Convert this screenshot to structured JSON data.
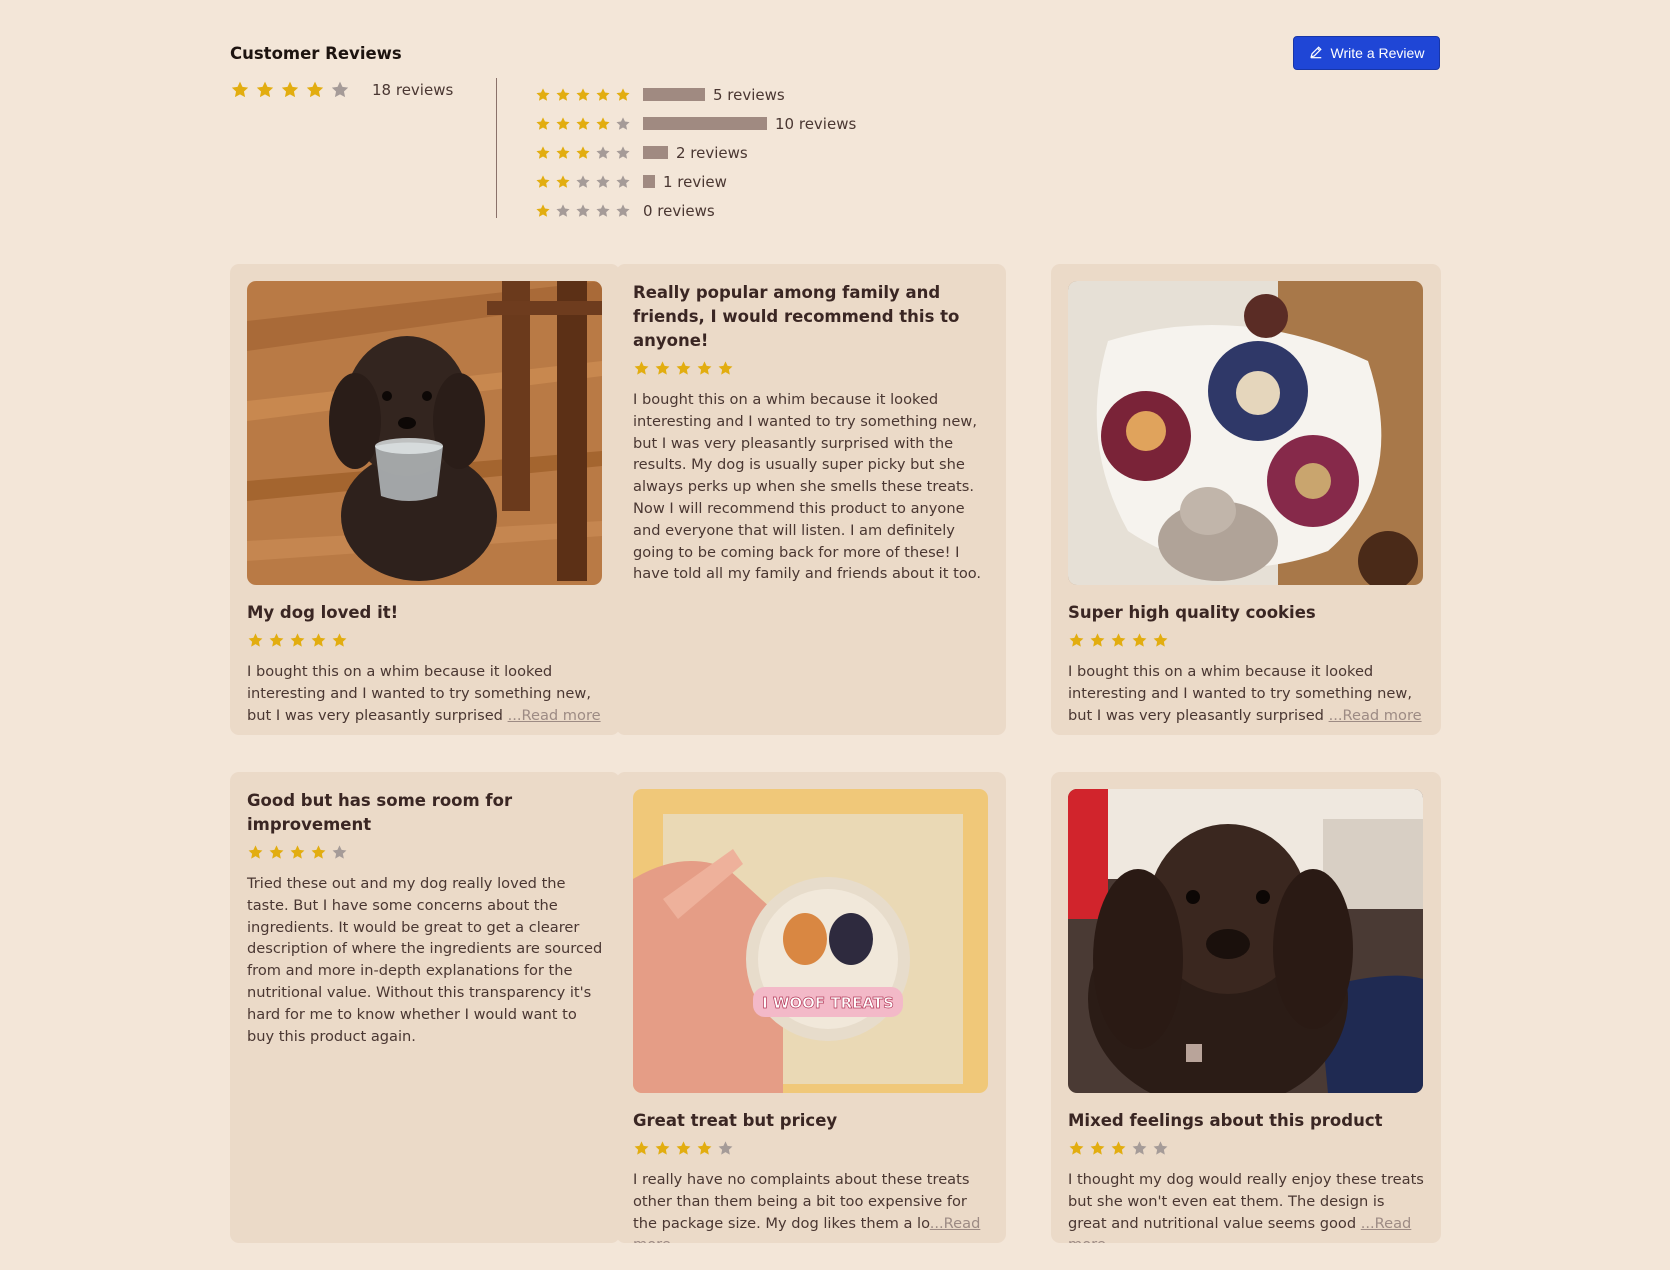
{
  "header": {
    "title": "Customer Reviews",
    "write_button_label": "Write a Review"
  },
  "summary": {
    "rating": 4,
    "review_count_label": "18 reviews"
  },
  "breakdown": [
    {
      "stars": 5,
      "count": 5,
      "label": "5 reviews"
    },
    {
      "stars": 4,
      "count": 10,
      "label": "10 reviews"
    },
    {
      "stars": 3,
      "count": 2,
      "label": "2 reviews"
    },
    {
      "stars": 2,
      "count": 1,
      "label": "1 review"
    },
    {
      "stars": 1,
      "count": 0,
      "label": "0 reviews"
    }
  ],
  "colors": {
    "star_filled": "#e2ad10",
    "star_empty": "#a59b98",
    "bar": "#a08a81",
    "button": "#1f46d6",
    "card_bg": "#ebdac8",
    "page_bg": "#f3e6d8"
  },
  "reviews": [
    {
      "title": "My dog loved it!",
      "rating": 5,
      "image": "photo of a dark curly dog holding a plastic container",
      "text": "I bought this on a whim because it looked interesting and I wanted to try something new, but I was very pleasantly surprised",
      "read_more": "...Read more"
    },
    {
      "title": "Really popular among family and friends, I would recommend this to anyone!",
      "rating": 5,
      "text": "I bought this on a whim because it looked interesting and I wanted to try something new, but I was very pleasantly surprised with the results. My dog is usually super picky but she always perks up when she smells these treats. Now I will recommend this product to anyone and everyone that will listen. I am definitely going to be coming back for more of these! I have told all my family and friends about it too."
    },
    {
      "title": "Super high quality cookies",
      "rating": 5,
      "image": "photo of decorated ornament cookies on a white plate",
      "text": "I bought this on a whim because it looked interesting and I wanted to try something new, but I was very pleasantly surprised",
      "read_more": "...Read more"
    },
    {
      "title": "Good but has some room for improvement",
      "rating": 4,
      "text": "Tried these out and my dog really loved the taste. But I have some concerns about the ingredients. It would be great to get a clearer description of where the ingredients are sourced from and more in-depth explanations for the nutritional value. Without this transparency it's hard for me to know whether I would want to buy this product again."
    },
    {
      "title": "Great treat but pricey",
      "rating": 4,
      "image": "photo of a hand holding a packaged decorated cookie",
      "cookie_text": "I WOOF TREATS",
      "text": "I really have no complaints about these treats other than them being a bit too expensive for the package size. My dog likes them a lo",
      "read_more": "...Read more"
    },
    {
      "title": "Mixed feelings about this product",
      "rating": 3,
      "image": "close-up photo of a dark brown cocker spaniel",
      "text": "I thought my dog would really enjoy these treats but she won't even eat them. The design is great and nutritional value seems good ",
      "read_more": "...Read more"
    }
  ]
}
